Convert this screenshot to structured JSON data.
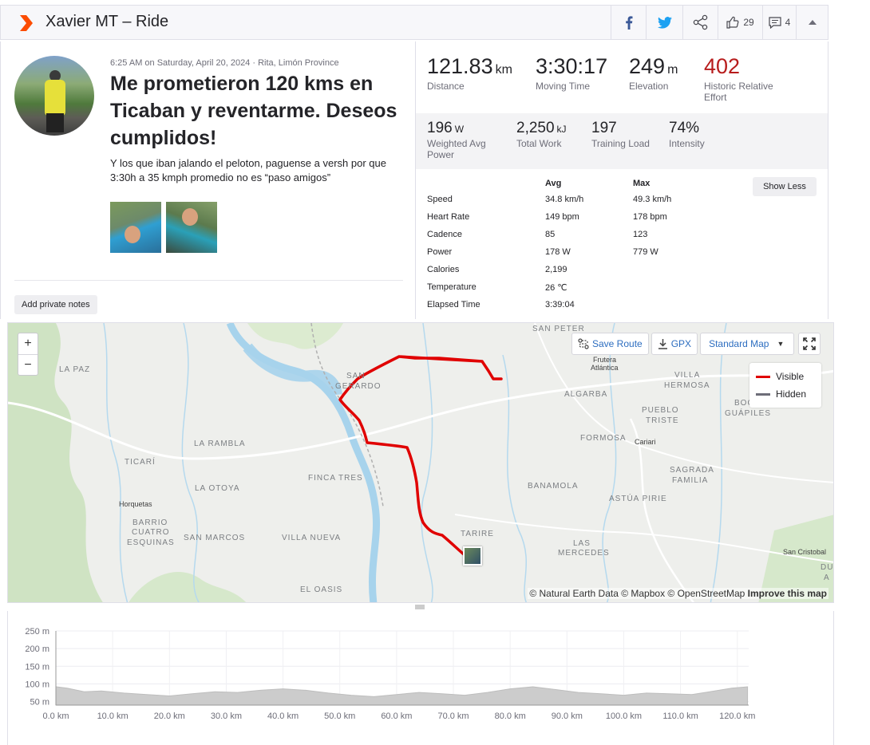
{
  "header": {
    "title": "Xavier MT – Ride",
    "kudos_count": "29",
    "comments_count": "4"
  },
  "activity": {
    "meta": "6:25 AM on Saturday, April 20, 2024 · Rita, Limón Province",
    "title": "Me prometieron 120 kms en Ticaban y reventarme. Deseos cumplidos!",
    "description": "Y los que iban jalando el peloton, paguense a versh por que 3:30h a 35 kmph promedio no es “paso amigos”",
    "private_notes_label": "Add private notes"
  },
  "stats": {
    "primary": [
      {
        "value": "121.83",
        "unit": "km",
        "label": "Distance"
      },
      {
        "value": "3:30:17",
        "unit": "",
        "label": "Moving Time"
      },
      {
        "value": "249",
        "unit": "m",
        "label": "Elevation"
      },
      {
        "value": "402",
        "unit": "",
        "label": "Historic Relative Effort"
      }
    ],
    "secondary": [
      {
        "value": "196",
        "unit": "W",
        "label": "Weighted Avg Power"
      },
      {
        "value": "2,250",
        "unit": "kJ",
        "label": "Total Work"
      },
      {
        "value": "197",
        "unit": "",
        "label": "Training Load"
      },
      {
        "value": "74%",
        "unit": "",
        "label": "Intensity"
      }
    ],
    "details_headers": {
      "avg": "Avg",
      "max": "Max"
    },
    "details": [
      {
        "label": "Speed",
        "avg": "34.8 km/h",
        "max": "49.3 km/h"
      },
      {
        "label": "Heart Rate",
        "avg": "149 bpm",
        "max": "178 bpm"
      },
      {
        "label": "Cadence",
        "avg": "85",
        "max": "123"
      },
      {
        "label": "Power",
        "avg": "178 W",
        "max": "779 W"
      },
      {
        "label": "Calories",
        "avg": "2,199",
        "max": ""
      },
      {
        "label": "Temperature",
        "avg": "26 ℃",
        "max": ""
      },
      {
        "label": "Elapsed Time",
        "avg": "3:39:04",
        "max": ""
      }
    ],
    "show_less_label": "Show Less"
  },
  "map": {
    "zoom_in": "+",
    "zoom_out": "−",
    "save_route": "Save Route",
    "gpx": "GPX",
    "map_type": "Standard Map",
    "legend_visible": "Visible",
    "legend_hidden": "Hidden",
    "attribution_text": "© Natural Earth Data © Mapbox © OpenStreetMap",
    "attribution_link": "Improve this map",
    "places": {
      "san_peter": "SAN PETER",
      "la_paz": "LA PAZ",
      "san_gerardo_1": "SAN",
      "san_gerardo_2": "GERARDO",
      "frutera_1": "Frutera",
      "frutera_2": "Atlántica",
      "villa_hermosa_1": "VILLA",
      "villa_hermosa_2": "HERMOSA",
      "algarba": "ALGARBA",
      "boca_guapiles_1": "BOC",
      "boca_guapiles_2": "GUÁPILES",
      "pueblo_triste_1": "PUEBLO",
      "pueblo_triste_2": "TRISTE",
      "la_rambla": "LA RAMBLA",
      "formosa": "FORMOSA",
      "cariari": "Cariari",
      "ticari": "TICARÍ",
      "sagrada_familia_1": "SAGRADA",
      "sagrada_familia_2": "FAMILIA",
      "finca_tres": "FINCA TRES",
      "la_otoya": "LA OTOYA",
      "banamola": "BANAMOLA",
      "astua_pirie": "ASTÚA PIRIE",
      "horquetas": "Horquetas",
      "barrio_1": "BARRIO",
      "barrio_2": "CUATRO",
      "barrio_3": "ESQUINAS",
      "san_marcos": "SAN MARCOS",
      "villa_nueva": "VILLA NUEVA",
      "tarire": "TARIRE",
      "las_mercedes_1": "LAS",
      "las_mercedes_2": "MERCEDES",
      "san_cristobal": "San Cristobal",
      "dua_1": "DU",
      "dua_2": "A",
      "el_oasis": "EL OASIS"
    },
    "colors": {
      "route": "#e00000",
      "hidden": "#6d6d78",
      "water": "#a7d3ec"
    }
  },
  "chart_data": {
    "type": "area",
    "title": "",
    "xlabel": "",
    "ylabel": "",
    "x_unit": "km",
    "y_unit": "m",
    "xlim": [
      0,
      122
    ],
    "ylim": [
      0,
      250
    ],
    "x_ticks": [
      "0.0 km",
      "10.0 km",
      "20.0 km",
      "30.0 km",
      "40.0 km",
      "50.0 km",
      "60.0 km",
      "70.0 km",
      "80.0 km",
      "90.0 km",
      "100.0 km",
      "110.0 km",
      "120.0 km"
    ],
    "y_ticks": [
      "250 m",
      "200 m",
      "150 m",
      "100 m",
      "50 m"
    ],
    "y_tick_values": [
      250,
      200,
      150,
      100,
      50
    ],
    "x": [
      0,
      2,
      5,
      8,
      12,
      16,
      20,
      24,
      28,
      32,
      36,
      40,
      44,
      48,
      52,
      56,
      60,
      64,
      68,
      72,
      76,
      80,
      84,
      88,
      92,
      96,
      100,
      104,
      108,
      112,
      116,
      119,
      121.8
    ],
    "series": [
      {
        "values": [
          92,
          88,
          78,
          80,
          74,
          70,
          66,
          72,
          78,
          76,
          82,
          86,
          82,
          74,
          68,
          64,
          70,
          76,
          72,
          68,
          76,
          86,
          92,
          84,
          76,
          72,
          68,
          74,
          72,
          70,
          80,
          88,
          92
        ]
      }
    ],
    "grid": true,
    "fill_color": "#cccccc"
  }
}
